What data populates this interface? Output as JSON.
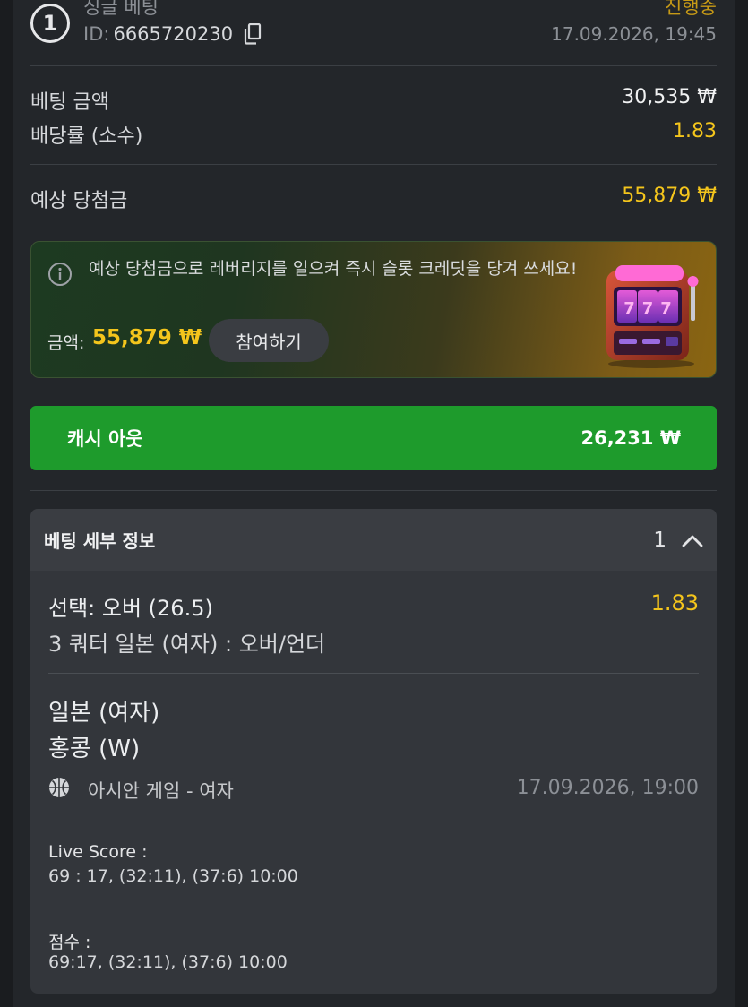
{
  "header": {
    "number": "1",
    "bet_type": "싱글 베팅",
    "id_label": "ID:",
    "id_value": "6665720230",
    "status": "진행중",
    "date": "17.09.2026, 19:45"
  },
  "summary": {
    "stake_label": "베팅 금액",
    "stake_value": "30,535 ₩",
    "odds_label": "배당률 (소수)",
    "odds_value": "1.83",
    "payout_label": "예상 당첨금",
    "payout_value": "55,879 ₩"
  },
  "promo": {
    "text": "예상 당첨금으로 레버리지를 일으켜 즉시 슬롯 크레딧을 당겨 쓰세요!",
    "amount_label": "금액:",
    "amount_value": "55,879 ₩",
    "join_label": "참여하기",
    "slot_digits": "777"
  },
  "cashout": {
    "label": "캐시 아웃",
    "value": "26,231 ₩"
  },
  "details": {
    "title": "베팅 세부 정보",
    "count": "1",
    "selection": "선택: 오버 (26.5)",
    "selection_odds": "1.83",
    "market": "3 쿼터 일본 (여자) : 오버/언더",
    "team_home": "일본 (여자)",
    "team_away": "홍콩 (W)",
    "league": "아시안 게임 - 여자",
    "match_date": "17.09.2026, 19:00",
    "live_score_label": "Live Score :",
    "live_score_value": "69 : 17, (32:11), (37:6) 10:00",
    "score_label": "점수 :",
    "score_value": "69:17, (32:11), (37:6) 10:00"
  },
  "colors": {
    "accent_yellow": "#f4c51c",
    "status_orange": "#c79a16",
    "cashout_green": "#1e9b2c"
  },
  "icons": {
    "copy": "copy-icon",
    "info": "info-icon",
    "chevron": "chevron-up-icon",
    "sport": "basketball-icon"
  }
}
